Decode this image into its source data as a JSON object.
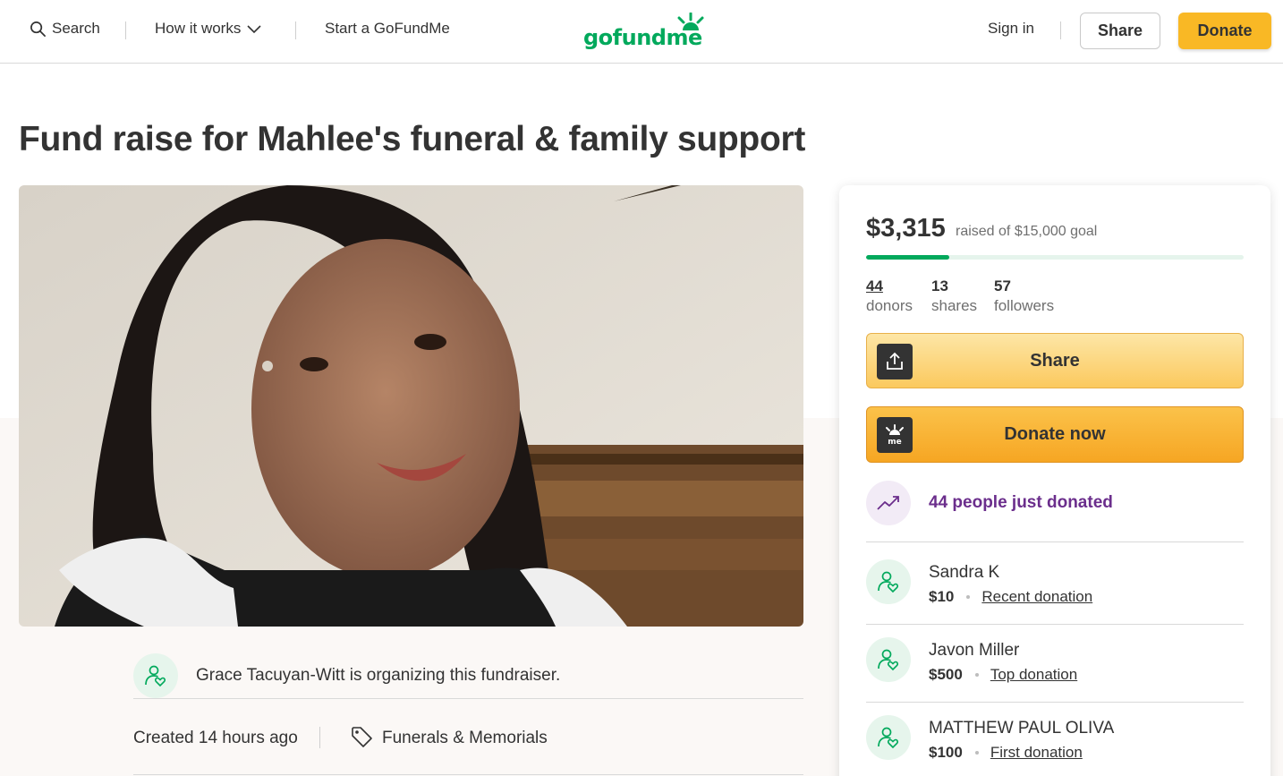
{
  "header": {
    "search_label": "Search",
    "how_it_works_label": "How it works",
    "start_label": "Start a GoFundMe",
    "logo_text": "gofundme",
    "sign_in_label": "Sign in",
    "share_label": "Share",
    "donate_label": "Donate"
  },
  "campaign": {
    "title": "Fund raise for Mahlee's funeral & family support",
    "organizer_text": "Grace Tacuyan-Witt is organizing this fundraiser.",
    "created": "Created 14 hours ago",
    "category": "Funerals & Memorials"
  },
  "sidebar": {
    "raised": "$3,315",
    "goal_text": "raised of $15,000 goal",
    "progress_fraction": 0.221,
    "stats": [
      {
        "value": "44",
        "label": "donors"
      },
      {
        "value": "13",
        "label": "shares"
      },
      {
        "value": "57",
        "label": "followers"
      }
    ],
    "share_button": "Share",
    "donate_button": "Donate now",
    "trend_text": "44 people just donated",
    "donations": [
      {
        "name": "Sandra K",
        "amount": "$10",
        "type": "Recent donation"
      },
      {
        "name": "Javon Miller",
        "amount": "$500",
        "type": "Top donation"
      },
      {
        "name": "MATTHEW PAUL OLIVA",
        "amount": "$100",
        "type": "First donation"
      }
    ]
  },
  "colors": {
    "brand_green": "#02a95c",
    "donate_yellow": "#f9b825",
    "trend_purple": "#6b2e8c"
  },
  "icons": {
    "search": "search-icon",
    "chevron": "chevron-down-icon",
    "share": "share-upload-icon",
    "donate": "gofundme-logo-icon",
    "trend": "trending-up-icon",
    "avatar": "person-heart-icon",
    "tag": "tag-icon"
  }
}
